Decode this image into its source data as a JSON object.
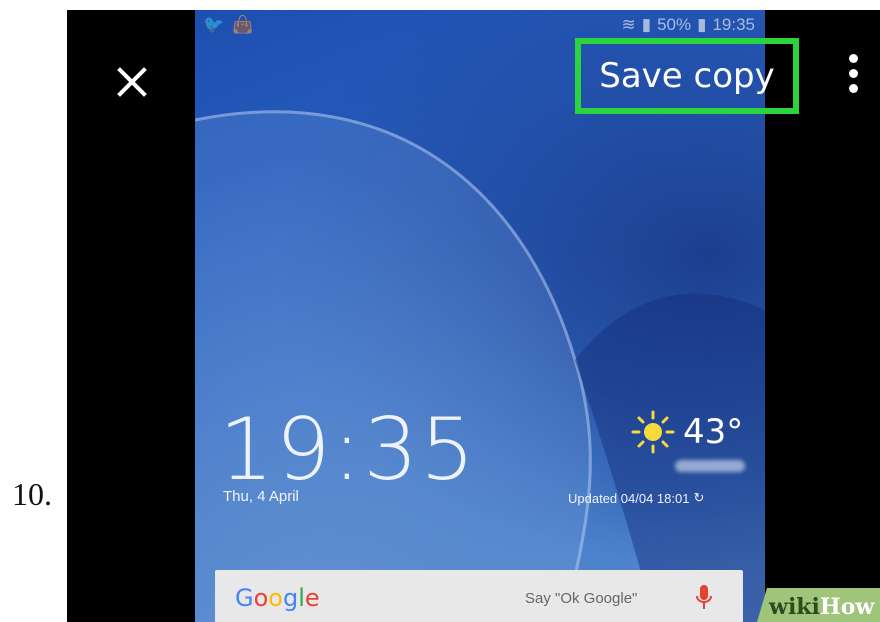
{
  "step": {
    "number": "10."
  },
  "toolbar": {
    "save_label": "Save copy",
    "close_icon": "close-icon",
    "more_icon": "more-vert-icon"
  },
  "status_bar": {
    "battery": "50%",
    "time": "19:35",
    "icons": [
      "twitter-icon",
      "shopping-bag-icon",
      "wifi-icon",
      "signal-icon",
      "battery-icon"
    ]
  },
  "lockscreen": {
    "clock": "19:35",
    "date": "Thu, 4 April",
    "temperature": "43°",
    "updated": "Updated 04/04 18:01",
    "weather_icon": "sun-icon"
  },
  "search_bar": {
    "logo": "Google",
    "hint": "Say \"Ok Google\"",
    "mic_icon": "mic-icon"
  },
  "watermark": {
    "wiki": "wiki",
    "how": "How"
  },
  "colors": {
    "highlight": "#2bd43e",
    "google_blue": "#4285F4",
    "google_red": "#EA4335",
    "google_yellow": "#FBBC05",
    "google_green": "#34A853"
  }
}
